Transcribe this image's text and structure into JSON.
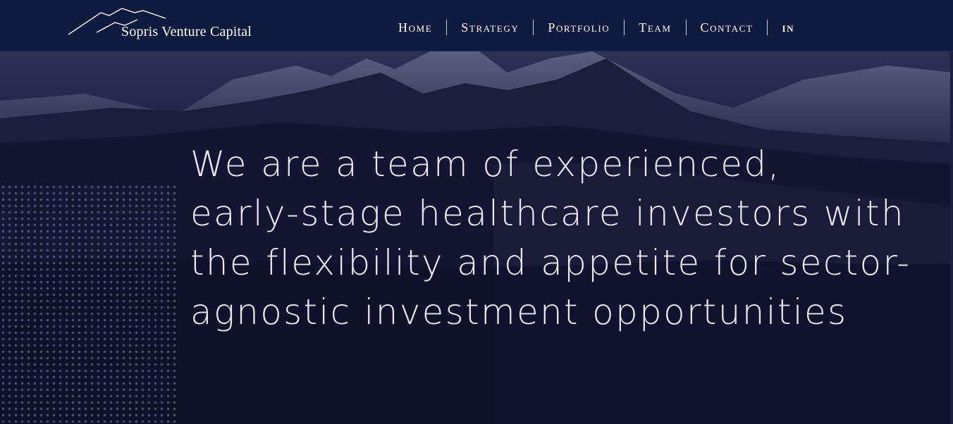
{
  "brand": {
    "name": "Sopris Venture Capital"
  },
  "nav": {
    "items": [
      {
        "label": "Home"
      },
      {
        "label": "Strategy"
      },
      {
        "label": "Portfolio"
      },
      {
        "label": "Team"
      },
      {
        "label": "Contact"
      }
    ],
    "social": {
      "label": "in",
      "icon": "linkedin-icon"
    }
  },
  "hero": {
    "lines": [
      "We are a team of experienced,",
      "early-stage healthcare investors with",
      "the flexibility and appetite for sector-",
      "agnostic investment opportunities"
    ]
  },
  "colors": {
    "header_bg": "#0f1a3f",
    "hero_overlay": "#12142e",
    "headline_text": "#e8e6ee"
  }
}
